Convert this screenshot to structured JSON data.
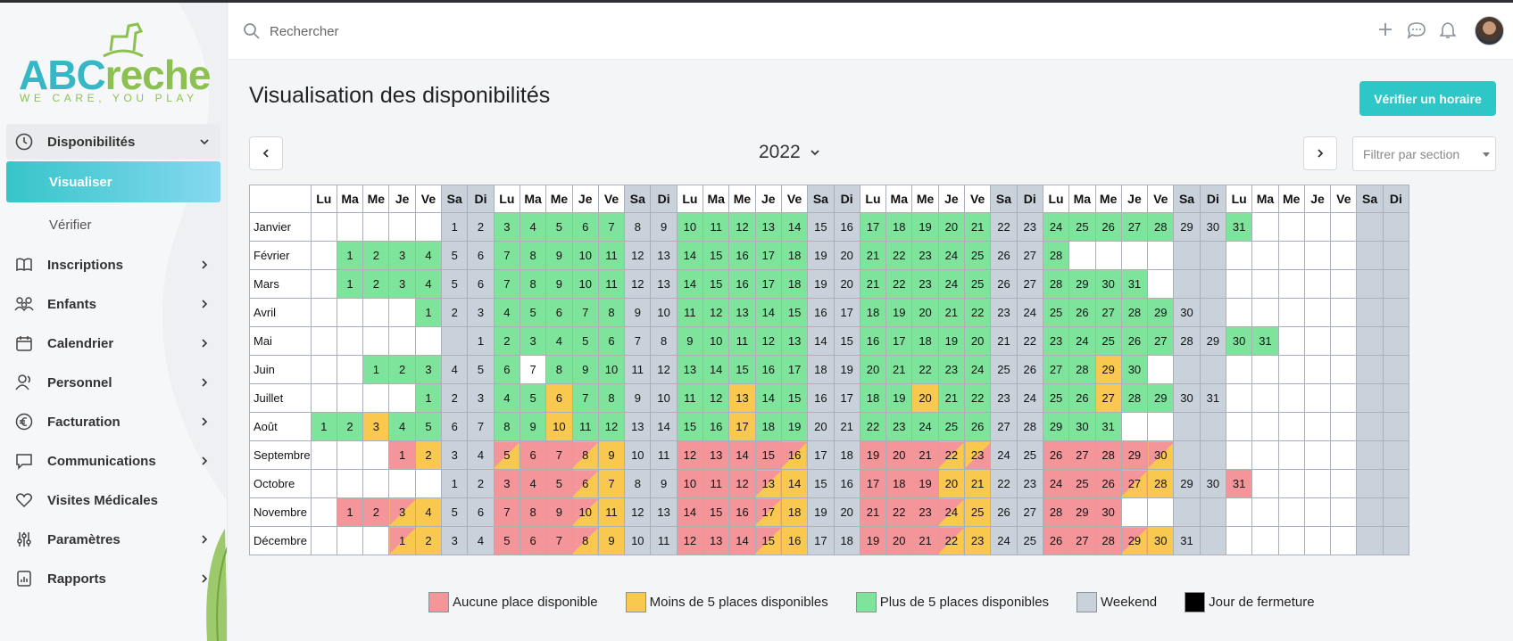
{
  "app": {
    "logo_main": "ABC",
    "logo_accent": "reche",
    "logo_tagline": "WE CARE, YOU PLAY"
  },
  "sidebar": {
    "items": [
      {
        "label": "Disponibilités",
        "icon": "clock-icon",
        "open": true
      },
      {
        "label": "Inscriptions",
        "icon": "book-icon"
      },
      {
        "label": "Enfants",
        "icon": "people-icon"
      },
      {
        "label": "Calendrier",
        "icon": "calendar-icon"
      },
      {
        "label": "Personnel",
        "icon": "person-icon"
      },
      {
        "label": "Facturation",
        "icon": "euro-icon"
      },
      {
        "label": "Communications",
        "icon": "chat-icon"
      },
      {
        "label": "Visites Médicales",
        "icon": "heart-icon"
      },
      {
        "label": "Paramètres",
        "icon": "sliders-icon"
      },
      {
        "label": "Rapports",
        "icon": "report-icon"
      }
    ],
    "subitems": [
      {
        "label": "Visualiser",
        "active": true
      },
      {
        "label": "Vérifier"
      }
    ]
  },
  "topbar": {
    "search_placeholder": "Rechercher"
  },
  "main": {
    "title": "Visualisation des disponibilités",
    "verify_button": "Vérifier un horaire",
    "year": "2022",
    "filter_placeholder": "Filtrer par section"
  },
  "calendar": {
    "weekday_headers": [
      "Lu",
      "Ma",
      "Me",
      "Je",
      "Ve",
      "Sa",
      "Di",
      "Lu",
      "Ma",
      "Me",
      "Je",
      "Ve",
      "Sa",
      "Di",
      "Lu",
      "Ma",
      "Me",
      "Je",
      "Ve",
      "Sa",
      "Di",
      "Lu",
      "Ma",
      "Me",
      "Je",
      "Ve",
      "Sa",
      "Di",
      "Lu",
      "Ma",
      "Me",
      "Je",
      "Ve",
      "Sa",
      "Di",
      "Lu",
      "Ma",
      "Me",
      "Je",
      "Ve",
      "Sa",
      "Di"
    ],
    "months": [
      {
        "name": "Janvier",
        "offset": 5,
        "days": 31,
        "status": {
          "3": "g",
          "4": "g",
          "5": "g",
          "6": "g",
          "7": "g",
          "10": "g",
          "11": "g",
          "12": "g",
          "13": "g",
          "14": "g",
          "17": "g",
          "18": "g",
          "19": "g",
          "20": "g",
          "21": "g",
          "24": "g",
          "25": "g",
          "26": "g",
          "27": "g",
          "28": "g",
          "31": "g"
        }
      },
      {
        "name": "Février",
        "offset": 1,
        "days": 28,
        "status": {
          "1": "g",
          "2": "g",
          "3": "g",
          "4": "g",
          "7": "g",
          "8": "g",
          "9": "g",
          "10": "g",
          "11": "g",
          "14": "g",
          "15": "g",
          "16": "g",
          "17": "g",
          "18": "g",
          "21": "g",
          "22": "g",
          "23": "g",
          "24": "g",
          "25": "g",
          "28": "g"
        }
      },
      {
        "name": "Mars",
        "offset": 1,
        "days": 31,
        "status": {
          "1": "g",
          "2": "g",
          "3": "g",
          "4": "g",
          "7": "g",
          "8": "g",
          "9": "g",
          "10": "g",
          "11": "g",
          "14": "g",
          "15": "g",
          "16": "g",
          "17": "g",
          "18": "g",
          "21": "g",
          "22": "g",
          "23": "g",
          "24": "g",
          "25": "g",
          "28": "g",
          "29": "g",
          "30": "g",
          "31": "g"
        }
      },
      {
        "name": "Avril",
        "offset": 4,
        "days": 30,
        "status": {
          "1": "g",
          "4": "g",
          "5": "g",
          "6": "g",
          "7": "g",
          "8": "g",
          "11": "g",
          "12": "g",
          "13": "g",
          "14": "g",
          "15": "g",
          "18": "g",
          "19": "g",
          "20": "g",
          "21": "g",
          "22": "g",
          "25": "g",
          "26": "g",
          "27": "g",
          "28": "g",
          "29": "g"
        }
      },
      {
        "name": "Mai",
        "offset": 6,
        "days": 31,
        "status": {
          "2": "g",
          "3": "g",
          "4": "g",
          "5": "g",
          "6": "g",
          "9": "g",
          "10": "g",
          "11": "g",
          "12": "g",
          "13": "g",
          "16": "g",
          "17": "g",
          "18": "g",
          "19": "g",
          "20": "g",
          "23": "g",
          "24": "g",
          "25": "g",
          "26": "g",
          "27": "g",
          "30": "g",
          "31": "g"
        }
      },
      {
        "name": "Juin",
        "offset": 2,
        "days": 30,
        "status": {
          "1": "g",
          "2": "g",
          "3": "g",
          "6": "g",
          "7": "white",
          "8": "g",
          "9": "g",
          "10": "g",
          "13": "g",
          "14": "g",
          "15": "g",
          "16": "g",
          "17": "g",
          "20": "g",
          "21": "g",
          "22": "g",
          "23": "g",
          "24": "g",
          "27": "g",
          "28": "g",
          "29": "o",
          "30": "g"
        }
      },
      {
        "name": "Juillet",
        "offset": 4,
        "days": 31,
        "status": {
          "1": "g",
          "4": "g",
          "5": "g",
          "6": "o",
          "7": "g",
          "8": "g",
          "11": "g",
          "12": "g",
          "13": "o",
          "14": "g",
          "15": "g",
          "18": "g",
          "19": "g",
          "20": "o",
          "21": "g",
          "22": "g",
          "25": "g",
          "26": "g",
          "27": "o",
          "28": "g",
          "29": "g"
        }
      },
      {
        "name": "Août",
        "offset": 0,
        "days": 31,
        "status": {
          "1": "g",
          "2": "g",
          "3": "o",
          "4": "g",
          "5": "g",
          "8": "g",
          "9": "g",
          "10": "o",
          "11": "g",
          "12": "g",
          "15": "g",
          "16": "g",
          "17": "o",
          "18": "g",
          "19": "g",
          "22": "g",
          "23": "g",
          "24": "g",
          "25": "g",
          "26": "g",
          "29": "g",
          "30": "g",
          "31": "g"
        }
      },
      {
        "name": "Septembre",
        "offset": 3,
        "days": 30,
        "status": {
          "1": "r",
          "2": "o",
          "5": "ro",
          "6": "r",
          "7": "r",
          "8": "ro",
          "9": "o",
          "12": "r",
          "13": "r",
          "14": "r",
          "15": "r",
          "16": "ro",
          "19": "r",
          "20": "r",
          "21": "r",
          "22": "ro",
          "23": "or",
          "26": "r",
          "27": "r",
          "28": "r",
          "29": "r",
          "30": "ro"
        }
      },
      {
        "name": "Octobre",
        "offset": 5,
        "days": 31,
        "status": {
          "3": "r",
          "4": "r",
          "5": "r",
          "6": "ro",
          "7": "o",
          "10": "r",
          "11": "r",
          "12": "r",
          "13": "ro",
          "14": "o",
          "17": "r",
          "18": "r",
          "19": "r",
          "20": "o",
          "21": "o",
          "24": "r",
          "25": "r",
          "26": "r",
          "27": "ro",
          "28": "o",
          "31": "r"
        }
      },
      {
        "name": "Novembre",
        "offset": 1,
        "days": 30,
        "status": {
          "1": "r",
          "2": "r",
          "3": "ro",
          "4": "o",
          "7": "r",
          "8": "r",
          "9": "r",
          "10": "ro",
          "11": "o",
          "14": "r",
          "15": "r",
          "16": "r",
          "17": "ro",
          "18": "o",
          "21": "r",
          "22": "r",
          "23": "r",
          "24": "ro",
          "25": "o",
          "28": "r",
          "29": "r",
          "30": "r"
        }
      },
      {
        "name": "Décembre",
        "offset": 3,
        "days": 31,
        "status": {
          "1": "ro",
          "2": "o",
          "5": "r",
          "6": "r",
          "7": "r",
          "8": "ro",
          "9": "o",
          "12": "r",
          "13": "r",
          "14": "r",
          "15": "ro",
          "16": "o",
          "19": "r",
          "20": "r",
          "21": "r",
          "22": "ro",
          "23": "o",
          "26": "r",
          "27": "r",
          "28": "r",
          "29": "ro",
          "30": "o"
        }
      }
    ]
  },
  "legend": [
    {
      "label": "Aucune place disponible",
      "color": "#f4959a"
    },
    {
      "label": "Moins de 5 places disponibles",
      "color": "#f9c94f"
    },
    {
      "label": "Plus de 5 places disponibles",
      "color": "#7ee49c"
    },
    {
      "label": "Weekend",
      "color": "#c9d1da"
    },
    {
      "label": "Jour de fermeture",
      "color": "#000000"
    }
  ]
}
